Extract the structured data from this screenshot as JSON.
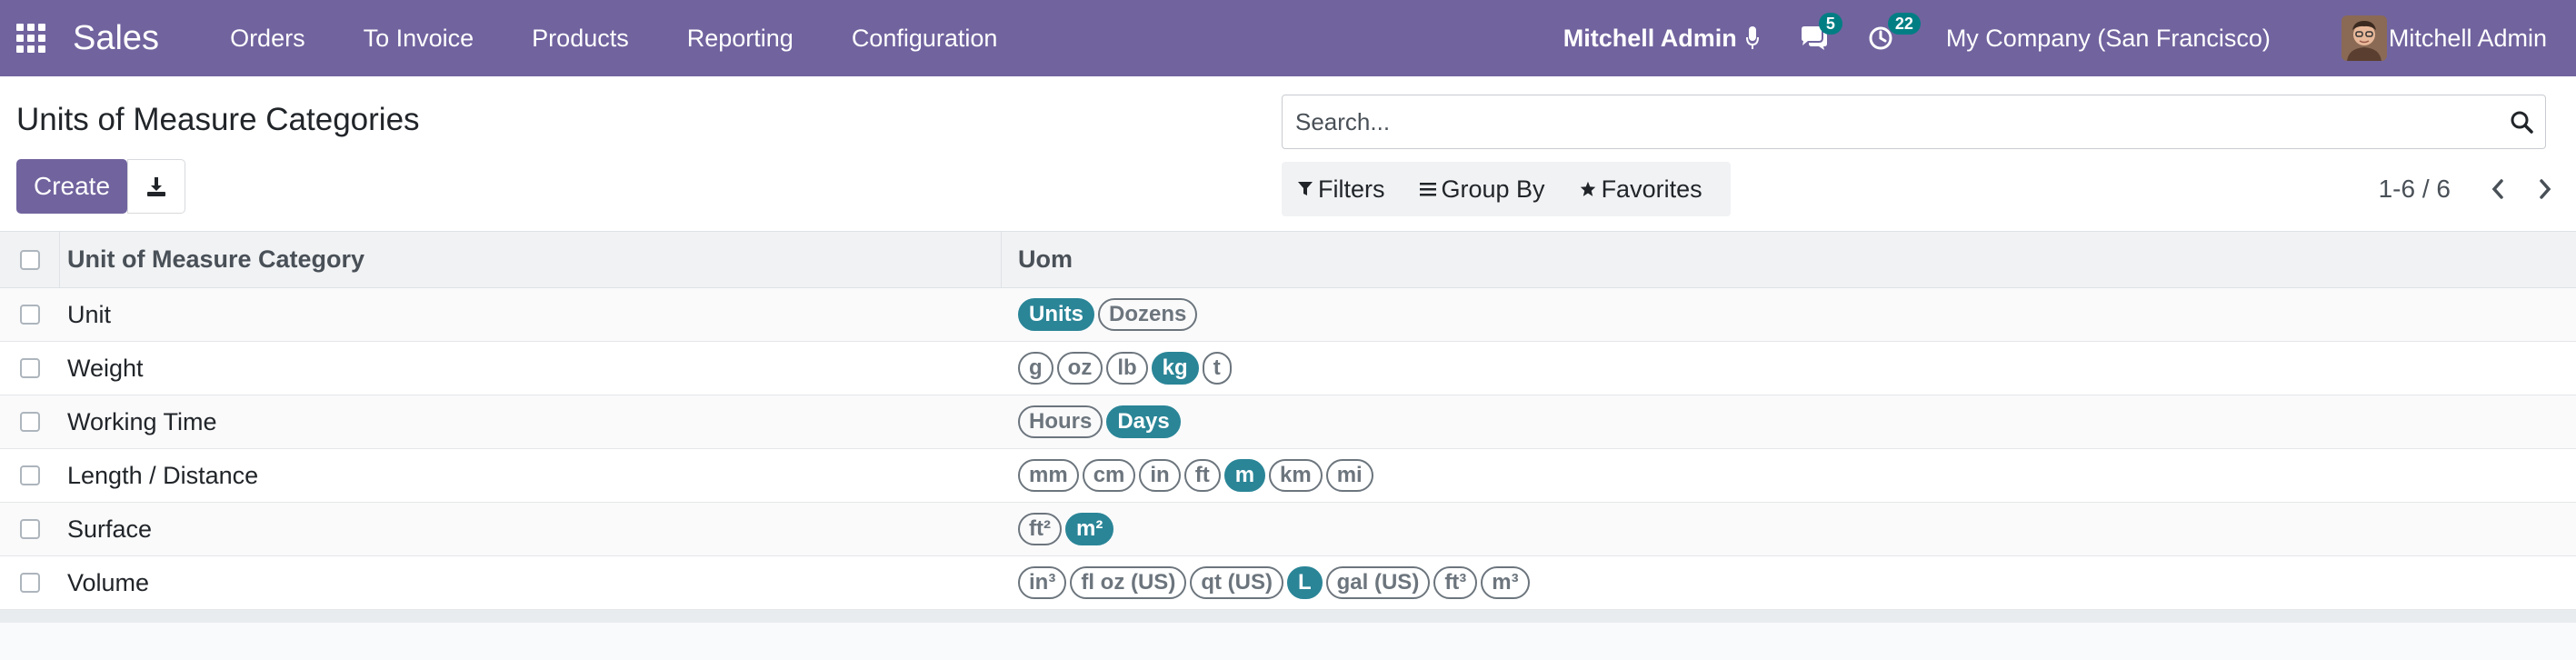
{
  "navbar": {
    "app_name": "Sales",
    "menu": [
      "Orders",
      "To Invoice",
      "Products",
      "Reporting",
      "Configuration"
    ],
    "user_strong": "Mitchell Admin",
    "messages_count": "5",
    "activities_count": "22",
    "company": "My Company (San Francisco)",
    "user": "Mitchell Admin",
    "accent_color": "#71639e"
  },
  "control": {
    "title": "Units of Measure Categories",
    "create_label": "Create",
    "search_placeholder": "Search...",
    "filters_label": "Filters",
    "group_by_label": "Group By",
    "favorites_label": "Favorites",
    "pager_value": "1-6 / 6"
  },
  "table": {
    "headers": {
      "category": "Unit of Measure Category",
      "uom": "Uom"
    },
    "rows": [
      {
        "category": "Unit",
        "uoms": [
          {
            "name": "Units",
            "ref": true
          },
          {
            "name": "Dozens",
            "ref": false
          }
        ]
      },
      {
        "category": "Weight",
        "uoms": [
          {
            "name": "g",
            "ref": false
          },
          {
            "name": "oz",
            "ref": false
          },
          {
            "name": "lb",
            "ref": false
          },
          {
            "name": "kg",
            "ref": true
          },
          {
            "name": "t",
            "ref": false
          }
        ]
      },
      {
        "category": "Working Time",
        "uoms": [
          {
            "name": "Hours",
            "ref": false
          },
          {
            "name": "Days",
            "ref": true
          }
        ]
      },
      {
        "category": "Length / Distance",
        "uoms": [
          {
            "name": "mm",
            "ref": false
          },
          {
            "name": "cm",
            "ref": false
          },
          {
            "name": "in",
            "ref": false
          },
          {
            "name": "ft",
            "ref": false
          },
          {
            "name": "m",
            "ref": true
          },
          {
            "name": "km",
            "ref": false
          },
          {
            "name": "mi",
            "ref": false
          }
        ]
      },
      {
        "category": "Surface",
        "uoms": [
          {
            "name": "ft²",
            "ref": false
          },
          {
            "name": "m²",
            "ref": true
          }
        ]
      },
      {
        "category": "Volume",
        "uoms": [
          {
            "name": "in³",
            "ref": false
          },
          {
            "name": "fl oz (US)",
            "ref": false
          },
          {
            "name": "qt (US)",
            "ref": false
          },
          {
            "name": "L",
            "ref": true
          },
          {
            "name": "gal (US)",
            "ref": false
          },
          {
            "name": "ft³",
            "ref": false
          },
          {
            "name": "m³",
            "ref": false
          }
        ]
      }
    ],
    "ref_tag_color": "#2a8597"
  },
  "icons": [
    "apps-grid-icon",
    "microphone-icon",
    "chat-icon",
    "clock-icon",
    "download-icon",
    "search-icon",
    "filter-icon",
    "group-by-icon",
    "star-icon",
    "chevron-left-icon",
    "chevron-right-icon"
  ]
}
